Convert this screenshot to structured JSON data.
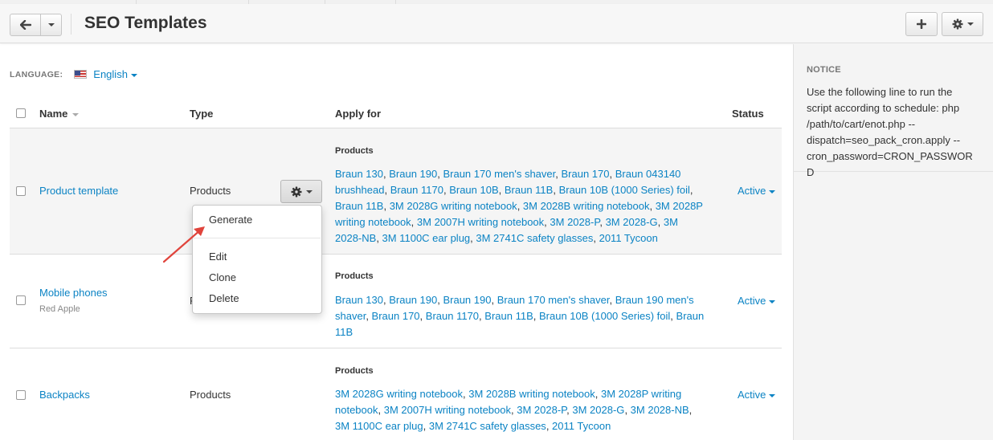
{
  "header": {
    "title": "SEO Templates"
  },
  "language": {
    "label": "LANGUAGE:",
    "value": "English"
  },
  "table": {
    "columns": {
      "name": "Name",
      "type": "Type",
      "apply_for": "Apply for",
      "status": "Status"
    },
    "rows": [
      {
        "name": "Product template",
        "subtitle": "",
        "type": "Products",
        "apply_title": "Products",
        "items": [
          "Braun 130",
          "Braun 190",
          "Braun 170 men's shaver",
          "Braun 170",
          "Braun 043140 brushhead",
          "Braun 1170",
          "Braun 10B",
          "Braun 11B",
          "Braun 10B (1000 Series) foil",
          "Braun 11B",
          "3M 2028G writing notebook",
          "3M 2028B writing notebook",
          "3M 2028P writing notebook",
          "3M 2007H writing notebook",
          "3M 2028-P",
          "3M 2028-G",
          "3M 2028-NB",
          "3M 1100C ear plug",
          "3M 2741C safety glasses",
          "2011 Tycoon"
        ],
        "status": "Active"
      },
      {
        "name": "Mobile phones",
        "subtitle": "Red Apple",
        "type": "P",
        "apply_title": "Products",
        "items": [
          "Braun 130",
          "Braun 190",
          "Braun 190",
          "Braun 170 men's shaver",
          "Braun 190 men's shaver",
          "Braun 170",
          "Braun 1170",
          "Braun 11B",
          "Braun 10B (1000 Series) foil",
          "Braun 11B"
        ],
        "status": "Active"
      },
      {
        "name": "Backpacks",
        "subtitle": "",
        "type": "Products",
        "apply_title": "Products",
        "items": [
          "3M 2028G writing notebook",
          "3M 2028B writing notebook",
          "3M 2028P writing notebook",
          "3M 2007H writing notebook",
          "3M 2028-P",
          "3M 2028-G",
          "3M 2028-NB",
          "3M 1100C ear plug",
          "3M 2741C safety glasses",
          "2011 Tycoon"
        ],
        "status": "Active"
      }
    ]
  },
  "dropdown_menu": {
    "generate": "Generate",
    "edit": "Edit",
    "clone": "Clone",
    "delete": "Delete"
  },
  "sidebar": {
    "notice_title": "NOTICE",
    "notice_text": "Use the following line to run the script according to schedule: php /path/to/cart/enot.php --dispatch=seo_pack_cron.apply --cron_password=CRON_PASSWORD"
  },
  "icons": {
    "back": "arrow-left-icon",
    "add": "plus-icon",
    "settings": "gear-icon"
  },
  "colors": {
    "link": "#0b83c4",
    "arrow": "#e0443c"
  }
}
